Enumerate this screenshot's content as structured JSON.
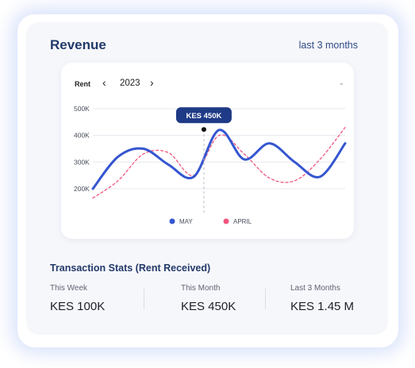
{
  "header": {
    "title": "Revenue",
    "range_label": "last 3 months"
  },
  "chart_controls": {
    "filter_label": "Rent",
    "prev_icon": "chevron-left-icon",
    "year": "2023",
    "next_icon": "chevron-right-icon",
    "dropdown_icon": "chevron-down-icon"
  },
  "chart_data": {
    "type": "line",
    "y_ticks": [
      "500K",
      "400K",
      "300K",
      "200K"
    ],
    "ylim": [
      150000,
      520000
    ],
    "x": [
      0,
      1,
      2,
      3,
      4,
      5,
      6,
      7,
      8,
      9,
      10
    ],
    "tooltip": {
      "label": "KES 450K",
      "x": 4.4,
      "y": 422000
    },
    "legend_position": "bottom",
    "series": [
      {
        "name": "MAY",
        "color": "#3556d0",
        "style": "solid",
        "values": [
          200000,
          320000,
          350000,
          290000,
          245000,
          420000,
          310000,
          370000,
          300000,
          245000,
          370000
        ]
      },
      {
        "name": "APRIL",
        "color": "#f0567d",
        "style": "dashed",
        "values": [
          165000,
          230000,
          330000,
          335000,
          250000,
          400000,
          330000,
          240000,
          230000,
          310000,
          430000
        ]
      }
    ]
  },
  "stats": {
    "title": "Transaction Stats (Rent Received)",
    "items": [
      {
        "label": "This Week",
        "value": "KES 100K"
      },
      {
        "label": "This Month",
        "value": "KES 450K"
      },
      {
        "label": "Last 3 Months",
        "value": "KES 1.45 M"
      }
    ]
  }
}
